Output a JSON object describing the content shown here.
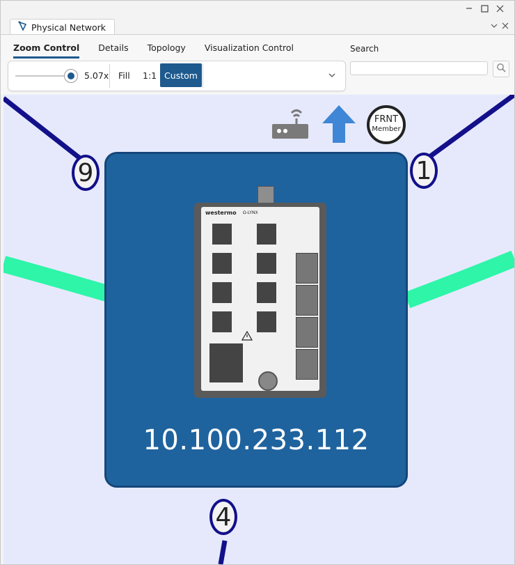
{
  "window": {
    "minimize_icon": "minimize-icon",
    "maximize_icon": "maximize-icon",
    "close_icon": "close-icon"
  },
  "doc_tab": {
    "label": "Physical Network",
    "icon": "network-icon"
  },
  "ribbon": {
    "tabs": [
      {
        "label": "Zoom Control",
        "active": true
      },
      {
        "label": "Details",
        "active": false
      },
      {
        "label": "Topology",
        "active": false
      },
      {
        "label": "Visualization Control",
        "active": false
      }
    ]
  },
  "zoom": {
    "value_label": "5.07x",
    "fill_label": "Fill",
    "one_to_one_label": "1:1",
    "custom_label": "Custom"
  },
  "search": {
    "label": "Search",
    "value": "",
    "placeholder": ""
  },
  "node": {
    "ip": "10.100.233.112",
    "device_brand": "westermo",
    "device_model": "Ω-LYNX",
    "badge_line1": "FRNT",
    "badge_line2": "Member"
  },
  "ports": {
    "left": "9",
    "right": "1",
    "bottom": "4"
  },
  "colors": {
    "accent": "#1e5a8e",
    "node_fill": "#1f639e",
    "link_dark": "#12108a",
    "link_green": "#2ef5a8",
    "canvas_bg": "#e6e9fc",
    "arrow_up": "#3f86d6"
  }
}
